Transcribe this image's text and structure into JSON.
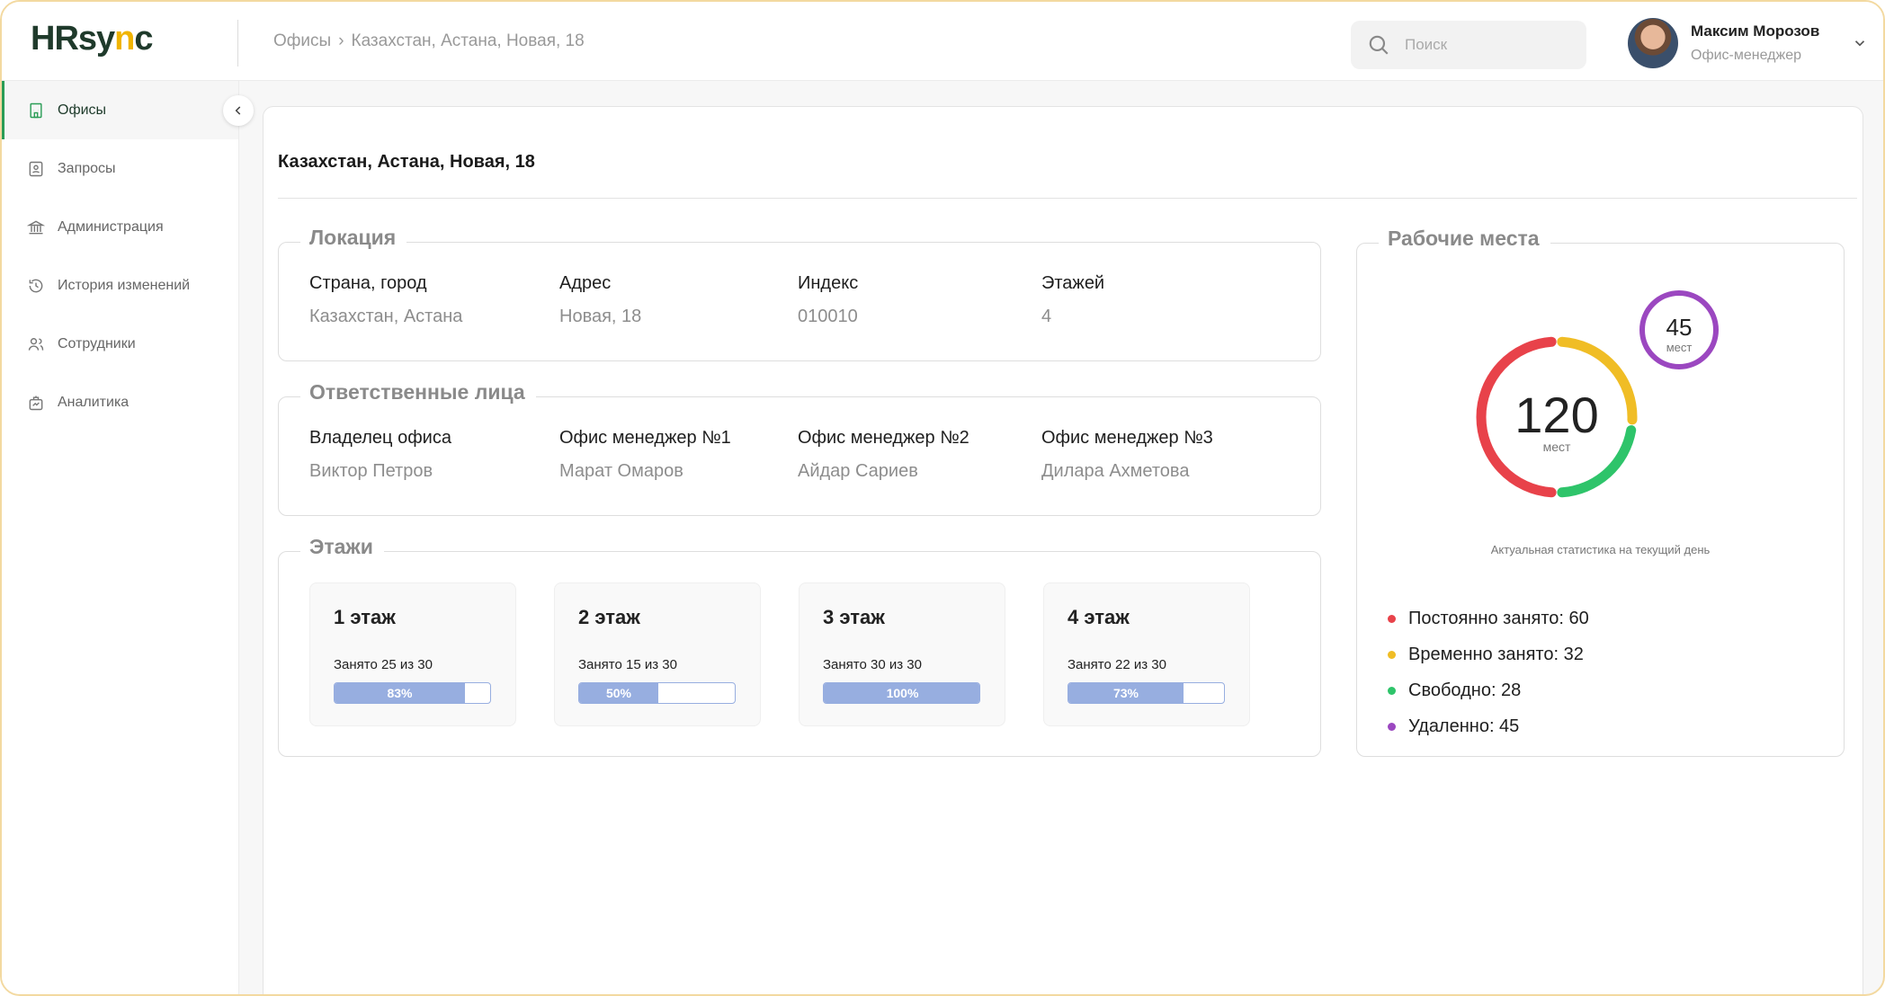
{
  "app": {
    "logo_main": "HRsy",
    "logo_accent": "n",
    "logo_tail": "c"
  },
  "breadcrumb": {
    "root": "Офисы",
    "separator": "›",
    "current": "Казахстан, Астана, Новая, 18"
  },
  "search": {
    "placeholder": "Поиск",
    "value": ""
  },
  "user": {
    "name": "Максим Морозов",
    "role": "Офис-менеджер"
  },
  "sidebar": {
    "items": [
      {
        "label": "Офисы",
        "icon": "building-icon",
        "active": true
      },
      {
        "label": "Запросы",
        "icon": "request-icon",
        "active": false
      },
      {
        "label": "Администрация",
        "icon": "bank-icon",
        "active": false
      },
      {
        "label": "История изменений",
        "icon": "history-icon",
        "active": false
      },
      {
        "label": "Сотрудники",
        "icon": "users-icon",
        "active": false
      },
      {
        "label": "Аналитика",
        "icon": "analytics-icon",
        "active": false
      }
    ]
  },
  "page": {
    "title": "Казахстан, Астана, Новая, 18"
  },
  "location": {
    "legend": "Локация",
    "fields": [
      {
        "label": "Страна, город",
        "value": "Казахстан, Астана"
      },
      {
        "label": "Адрес",
        "value": "Новая, 18"
      },
      {
        "label": "Индекс",
        "value": "010010"
      },
      {
        "label": "Этажей",
        "value": "4"
      }
    ]
  },
  "responsible": {
    "legend": "Ответственные лица",
    "fields": [
      {
        "label": "Владелец офиса",
        "value": "Виктор Петров"
      },
      {
        "label": "Офис менеджер №1",
        "value": "Марат Омаров"
      },
      {
        "label": "Офис менеджер №2",
        "value": "Айдар Сариев"
      },
      {
        "label": "Офис менеджер №3",
        "value": "Дилара Ахметова"
      }
    ]
  },
  "floors": {
    "legend": "Этажи",
    "items": [
      {
        "title": "1 этаж",
        "occupancy": "Занято 25 из 30",
        "percent_label": "83%",
        "fraction": 0.83
      },
      {
        "title": "2 этаж",
        "occupancy": "Занято 15 из 30",
        "percent_label": "50%",
        "fraction": 0.5
      },
      {
        "title": "3 этаж",
        "occupancy": "Занято 30 из 30",
        "percent_label": "100%",
        "fraction": 1.0
      },
      {
        "title": "4 этаж",
        "occupancy": "Занято 22 из 30",
        "percent_label": "73%",
        "fraction": 0.73
      }
    ]
  },
  "workplaces": {
    "legend": "Рабочие места",
    "total": "120",
    "total_unit": "мест",
    "remote_count": "45",
    "remote_unit": "мест",
    "caption": "Актуальная статистика на текущий день",
    "segments": [
      {
        "label": "Постоянно занято: 60",
        "value": 60,
        "color": "#e8424a"
      },
      {
        "label": "Временно занято: 32",
        "value": 32,
        "color": "#f0bd25"
      },
      {
        "label": "Свободно: 28",
        "value": 28,
        "color": "#2ec46a"
      }
    ],
    "remote": {
      "label": "Удаленно: 45",
      "value": 45,
      "color": "#9b47c0"
    }
  },
  "colors": {
    "accent_green": "#2a9d56",
    "bar_blue": "#97aee0",
    "logo_dark": "#1f3a2b",
    "logo_yellow": "#f0b400"
  }
}
